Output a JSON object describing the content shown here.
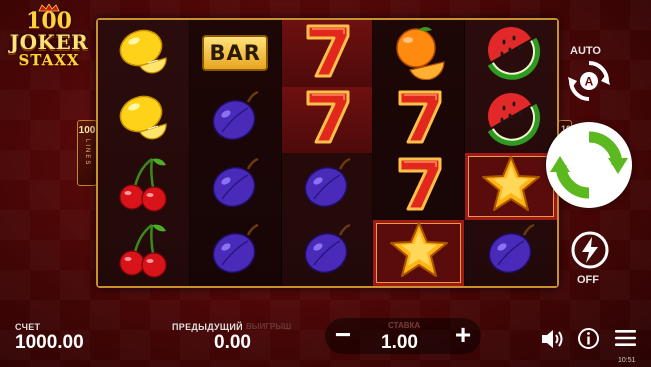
{
  "game": {
    "logo": {
      "top": "100",
      "middle": "JOKER",
      "bottom": "STAXX"
    },
    "lines": {
      "count": "100",
      "word": "LINES"
    }
  },
  "reels": [
    [
      "lemon",
      "lemon",
      "cherry",
      "cherry"
    ],
    [
      "bar",
      "plum",
      "plum",
      "plum"
    ],
    [
      "seven",
      "seven",
      "plum",
      "plum"
    ],
    [
      "orange",
      "seven",
      "seven",
      "star"
    ],
    [
      "watermelon",
      "watermelon",
      "star",
      "plum"
    ]
  ],
  "symbols": {
    "bar_label": "BAR"
  },
  "controls": {
    "auto_label": "AUTO",
    "auto_badge": "A",
    "turbo_off_label": "OFF",
    "spin_color": "#5cb81f"
  },
  "footer": {
    "balance_label": "СЧЕТ",
    "balance_value": "1000.00",
    "previous_label": "ПРЕДЫДУЩИЙ",
    "previous_sublabel": "ВЫИГРЫШ",
    "previous_value": "0.00",
    "bet_label": "СТАВКА",
    "bet_value": "1.00",
    "bet_minus": "−",
    "bet_plus": "+",
    "clock": "10:51"
  },
  "colors": {
    "frame_gold": "#c9912e",
    "background_red": "#7a1010",
    "plum_purple": "#4a2ab8",
    "seven_red": "#e2281c"
  }
}
